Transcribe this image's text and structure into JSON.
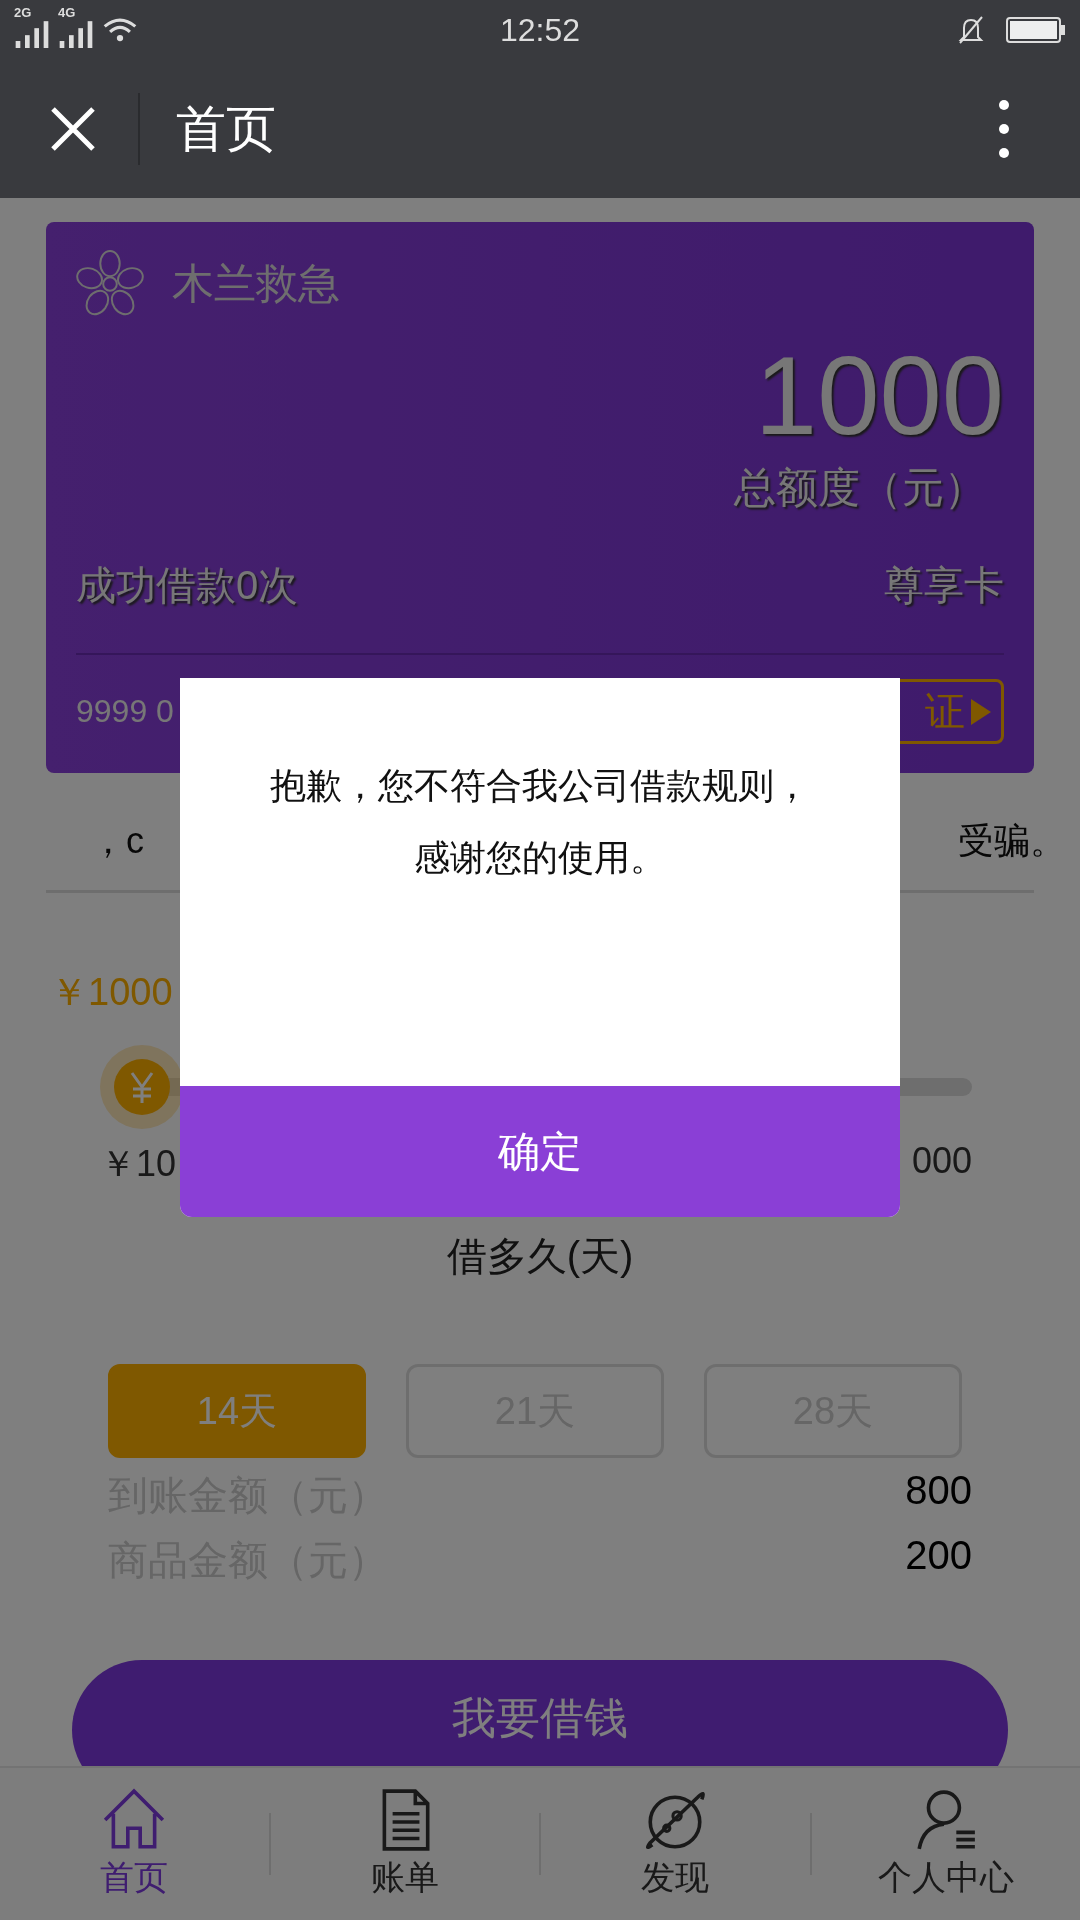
{
  "status_bar": {
    "time": "12:52",
    "signals": [
      {
        "label": "2G"
      },
      {
        "label": "4G"
      }
    ]
  },
  "header": {
    "title": "首页"
  },
  "card": {
    "brand": "木兰救急",
    "amount": "1000",
    "amount_label": "总额度（元）",
    "loan_count": "成功借款0次",
    "card_type": "尊享卡",
    "number": "9999 0",
    "verify_badge": "证"
  },
  "notice": {
    "left": "，c",
    "right": "受骗。"
  },
  "loan": {
    "amount": "￥1000",
    "slider": {
      "level": 0
    },
    "min": "￥10",
    "max": "000",
    "term_label": "借多久(天)",
    "terms": [
      {
        "label": "14天",
        "selected": true
      },
      {
        "label": "21天",
        "selected": false
      },
      {
        "label": "28天",
        "selected": false
      }
    ],
    "details": [
      {
        "label": "到账金额（元）",
        "value": "800"
      },
      {
        "label": "商品金额（元）",
        "value": "200"
      }
    ],
    "submit": "我要借钱"
  },
  "tab_bar": [
    {
      "label": "首页",
      "selected": true
    },
    {
      "label": "账单",
      "selected": false
    },
    {
      "label": "发现",
      "selected": false
    },
    {
      "label": "个人中心",
      "selected": false
    }
  ],
  "dialog": {
    "message": "抱歉，您不符合我公司借款规则，感谢您的使用。",
    "confirm": "确定"
  }
}
